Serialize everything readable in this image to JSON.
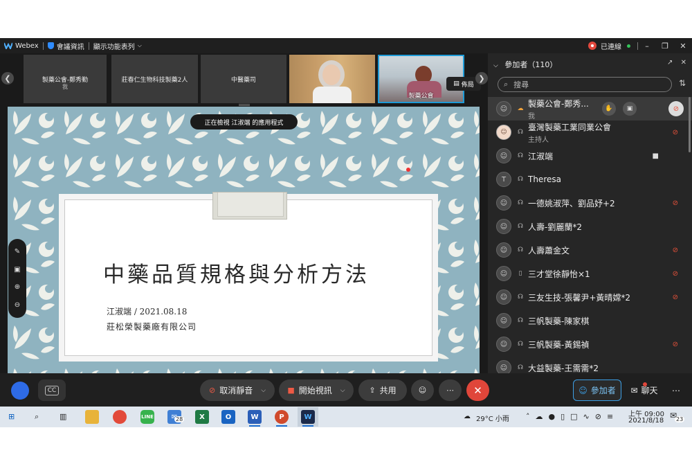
{
  "titlebar": {
    "app_name": "Webex",
    "meeting_info": "會議資訊",
    "feature_menu": "顯示功能表列",
    "status": "已連線"
  },
  "video_strip": {
    "tiles": [
      {
        "name": "製藥公會-鄭秀勤",
        "sub": "我"
      },
      {
        "name": "莊春仁生物科技製藥2人",
        "sub": ""
      },
      {
        "name": "中醫藥司",
        "sub": ""
      },
      {
        "name": "",
        "sub": ""
      },
      {
        "name": "製藥公會",
        "sub": ""
      }
    ],
    "layout_button": "佈局"
  },
  "share": {
    "notice": "正在檢視 江淑端 的應用程式",
    "slide": {
      "title": "中藥品質規格與分析方法",
      "author_date": "江淑端 / 2021.08.18",
      "company": "莊松榮製藥廠有限公司"
    }
  },
  "panel": {
    "title": "參加者（110）",
    "search_placeholder": "搜尋",
    "participants": [
      {
        "name": "製藥公會-鄭秀...",
        "sub": "我",
        "avatar": "person-icon",
        "muted": true,
        "me": true
      },
      {
        "name": "臺灣製藥工業同業公會",
        "sub": "主持人",
        "avatar": "host-photo",
        "muted": true
      },
      {
        "name": "江淑端",
        "sub": "",
        "avatar": "person-icon",
        "muted": false,
        "video": true
      },
      {
        "name": "Theresa",
        "sub": "",
        "avatar": "T",
        "muted": false
      },
      {
        "name": "一德姚淑萍、劉品妤+2",
        "sub": "",
        "avatar": "person-icon",
        "muted": true
      },
      {
        "name": "人壽-劉麗蘭*2",
        "sub": "",
        "avatar": "person-icon",
        "muted": false
      },
      {
        "name": "人壽蕭金文",
        "sub": "",
        "avatar": "person-icon",
        "muted": true
      },
      {
        "name": "三才堂徐靜怡×1",
        "sub": "",
        "avatar": "person-icon",
        "muted": true,
        "phone": true
      },
      {
        "name": "三友生技-張馨尹+黃晴嫦*2",
        "sub": "",
        "avatar": "person-icon",
        "muted": true
      },
      {
        "name": "三帆製藥-陳家棋",
        "sub": "",
        "avatar": "person-icon",
        "muted": false
      },
      {
        "name": "三帆製藥-黃錫禎",
        "sub": "",
        "avatar": "person-icon",
        "muted": true
      },
      {
        "name": "大益製藥-王需需*2",
        "sub": "",
        "avatar": "person-icon",
        "muted": false
      }
    ]
  },
  "controls": {
    "unmute": "取消靜音",
    "start_video": "開始視訊",
    "share": "共用",
    "participants_tab": "參加者",
    "chat_tab": "聊天",
    "cc": "CC"
  },
  "taskbar": {
    "mail_badge": "28",
    "weather": "29°C 小雨",
    "time": "上午 09:00",
    "date": "2021/8/18",
    "notifications": "23"
  },
  "colors": {
    "accent": "#3da0e6",
    "mute_red": "#e8513a",
    "end_red": "#e0463a",
    "slide_bg": "#8fb3c0"
  }
}
